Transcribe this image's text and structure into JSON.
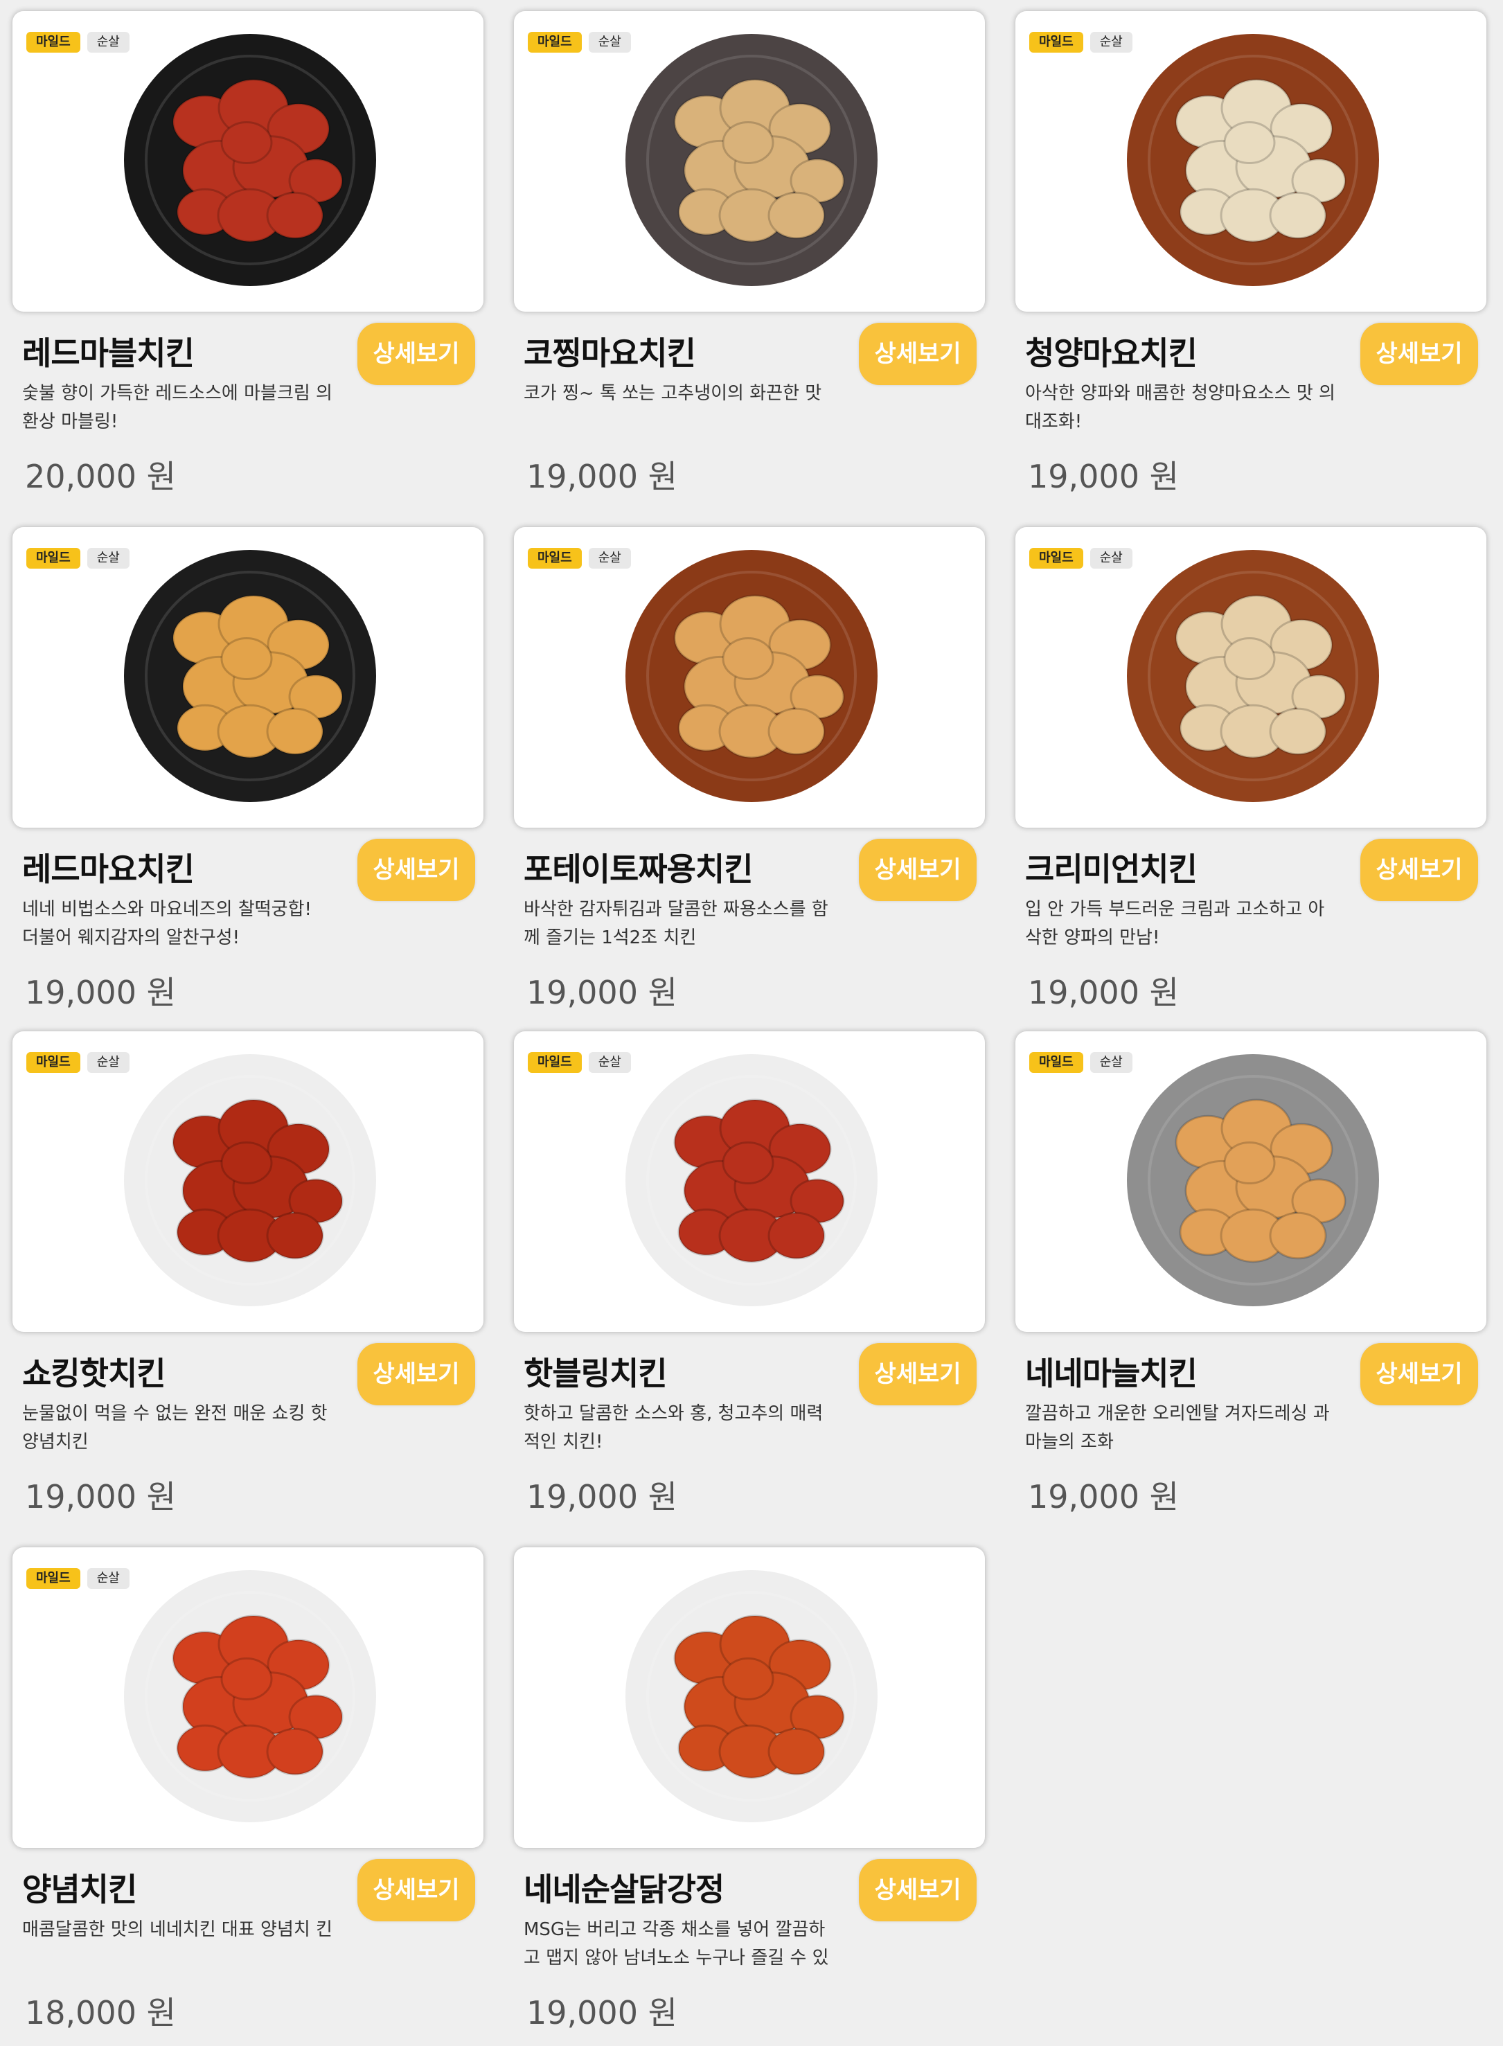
{
  "products": [
    {
      "tags": [
        "마일드",
        "순살"
      ],
      "name": "레드마블치킨",
      "desc": "숯불 향이 가득한 레드소스에 마블크림 의환상 마블링!",
      "price": "20,000 원",
      "button": "상세보기",
      "plate_color": "#181818",
      "food_color": "#b8321f"
    },
    {
      "tags": [
        "마일드",
        "순살"
      ],
      "name": "코찡마요치킨",
      "desc": "코가 찡~ 톡 쏘는 고추냉이의 화끈한 맛",
      "price": "19,000 원",
      "button": "상세보기",
      "plate_color": "#4c4444",
      "food_color": "#d9b27a"
    },
    {
      "tags": [
        "마일드",
        "순살"
      ],
      "name": "청양마요치킨",
      "desc": "아삭한 양파와 매콤한 청양마요소스 맛 의 대조화!",
      "price": "19,000 원",
      "button": "상세보기",
      "plate_color": "#8e3d1a",
      "food_color": "#e9dcc0"
    },
    {
      "tags": [
        "마일드",
        "순살"
      ],
      "name": "레드마요치킨",
      "desc": "네네 비법소스와 마요네즈의 찰떡궁합! 더불어 웨지감자의 알찬구성!",
      "price": "19,000 원",
      "button": "상세보기",
      "plate_color": "#1c1c1c",
      "food_color": "#e3a34a"
    },
    {
      "tags": [
        "마일드",
        "순살"
      ],
      "name": "포테이토짜용치킨",
      "desc": "바삭한 감자튀김과 달콤한 짜용소스를 함께 즐기는 1석2조 치킨",
      "price": "19,000 원",
      "button": "상세보기",
      "plate_color": "#8b3a17",
      "food_color": "#e0a55c"
    },
    {
      "tags": [
        "마일드",
        "순살"
      ],
      "name": "크리미언치킨",
      "desc": "입 안 가득 부드러운 크림과 고소하고 아삭한 양파의 만남!",
      "price": "19,000 원",
      "button": "상세보기",
      "plate_color": "#93421c",
      "food_color": "#e6cfa8"
    },
    {
      "tags": [
        "마일드",
        "순살"
      ],
      "name": "쇼킹핫치킨",
      "desc": "눈물없이 먹을 수 없는 완전 매운 쇼킹 핫양념치킨",
      "price": "19,000 원",
      "button": "상세보기",
      "plate_color": "#eeeeee",
      "food_color": "#b02a14"
    },
    {
      "tags": [
        "마일드",
        "순살"
      ],
      "name": "핫블링치킨",
      "desc": "핫하고 달콤한 소스와 홍, 청고추의 매력적인 치킨!",
      "price": "19,000 원",
      "button": "상세보기",
      "plate_color": "#eeeeee",
      "food_color": "#b8301c"
    },
    {
      "tags": [
        "마일드",
        "순살"
      ],
      "name": "네네마늘치킨",
      "desc": "깔끔하고 개운한 오리엔탈 겨자드레싱 과 마늘의 조화",
      "price": "19,000 원",
      "button": "상세보기",
      "plate_color": "#8f8f8f",
      "food_color": "#e2a158"
    },
    {
      "tags": [
        "마일드",
        "순살"
      ],
      "name": "양념치킨",
      "desc": "매콤달콤한 맛의 네네치킨 대표 양념치 킨",
      "price": "18,000 원",
      "button": "상세보기",
      "plate_color": "#eeeeee",
      "food_color": "#d2401e"
    },
    {
      "tags": [],
      "name": "네네순살닭강정",
      "desc": "MSG는 버리고 각종 채소를 넣어 깔끔하고 맵지 않아 남녀노소 누구나 즐길 수 있는 순살닭강정",
      "price": "19,000 원",
      "button": "상세보기",
      "plate_color": "#eeeeee",
      "food_color": "#cf4b1c"
    }
  ]
}
